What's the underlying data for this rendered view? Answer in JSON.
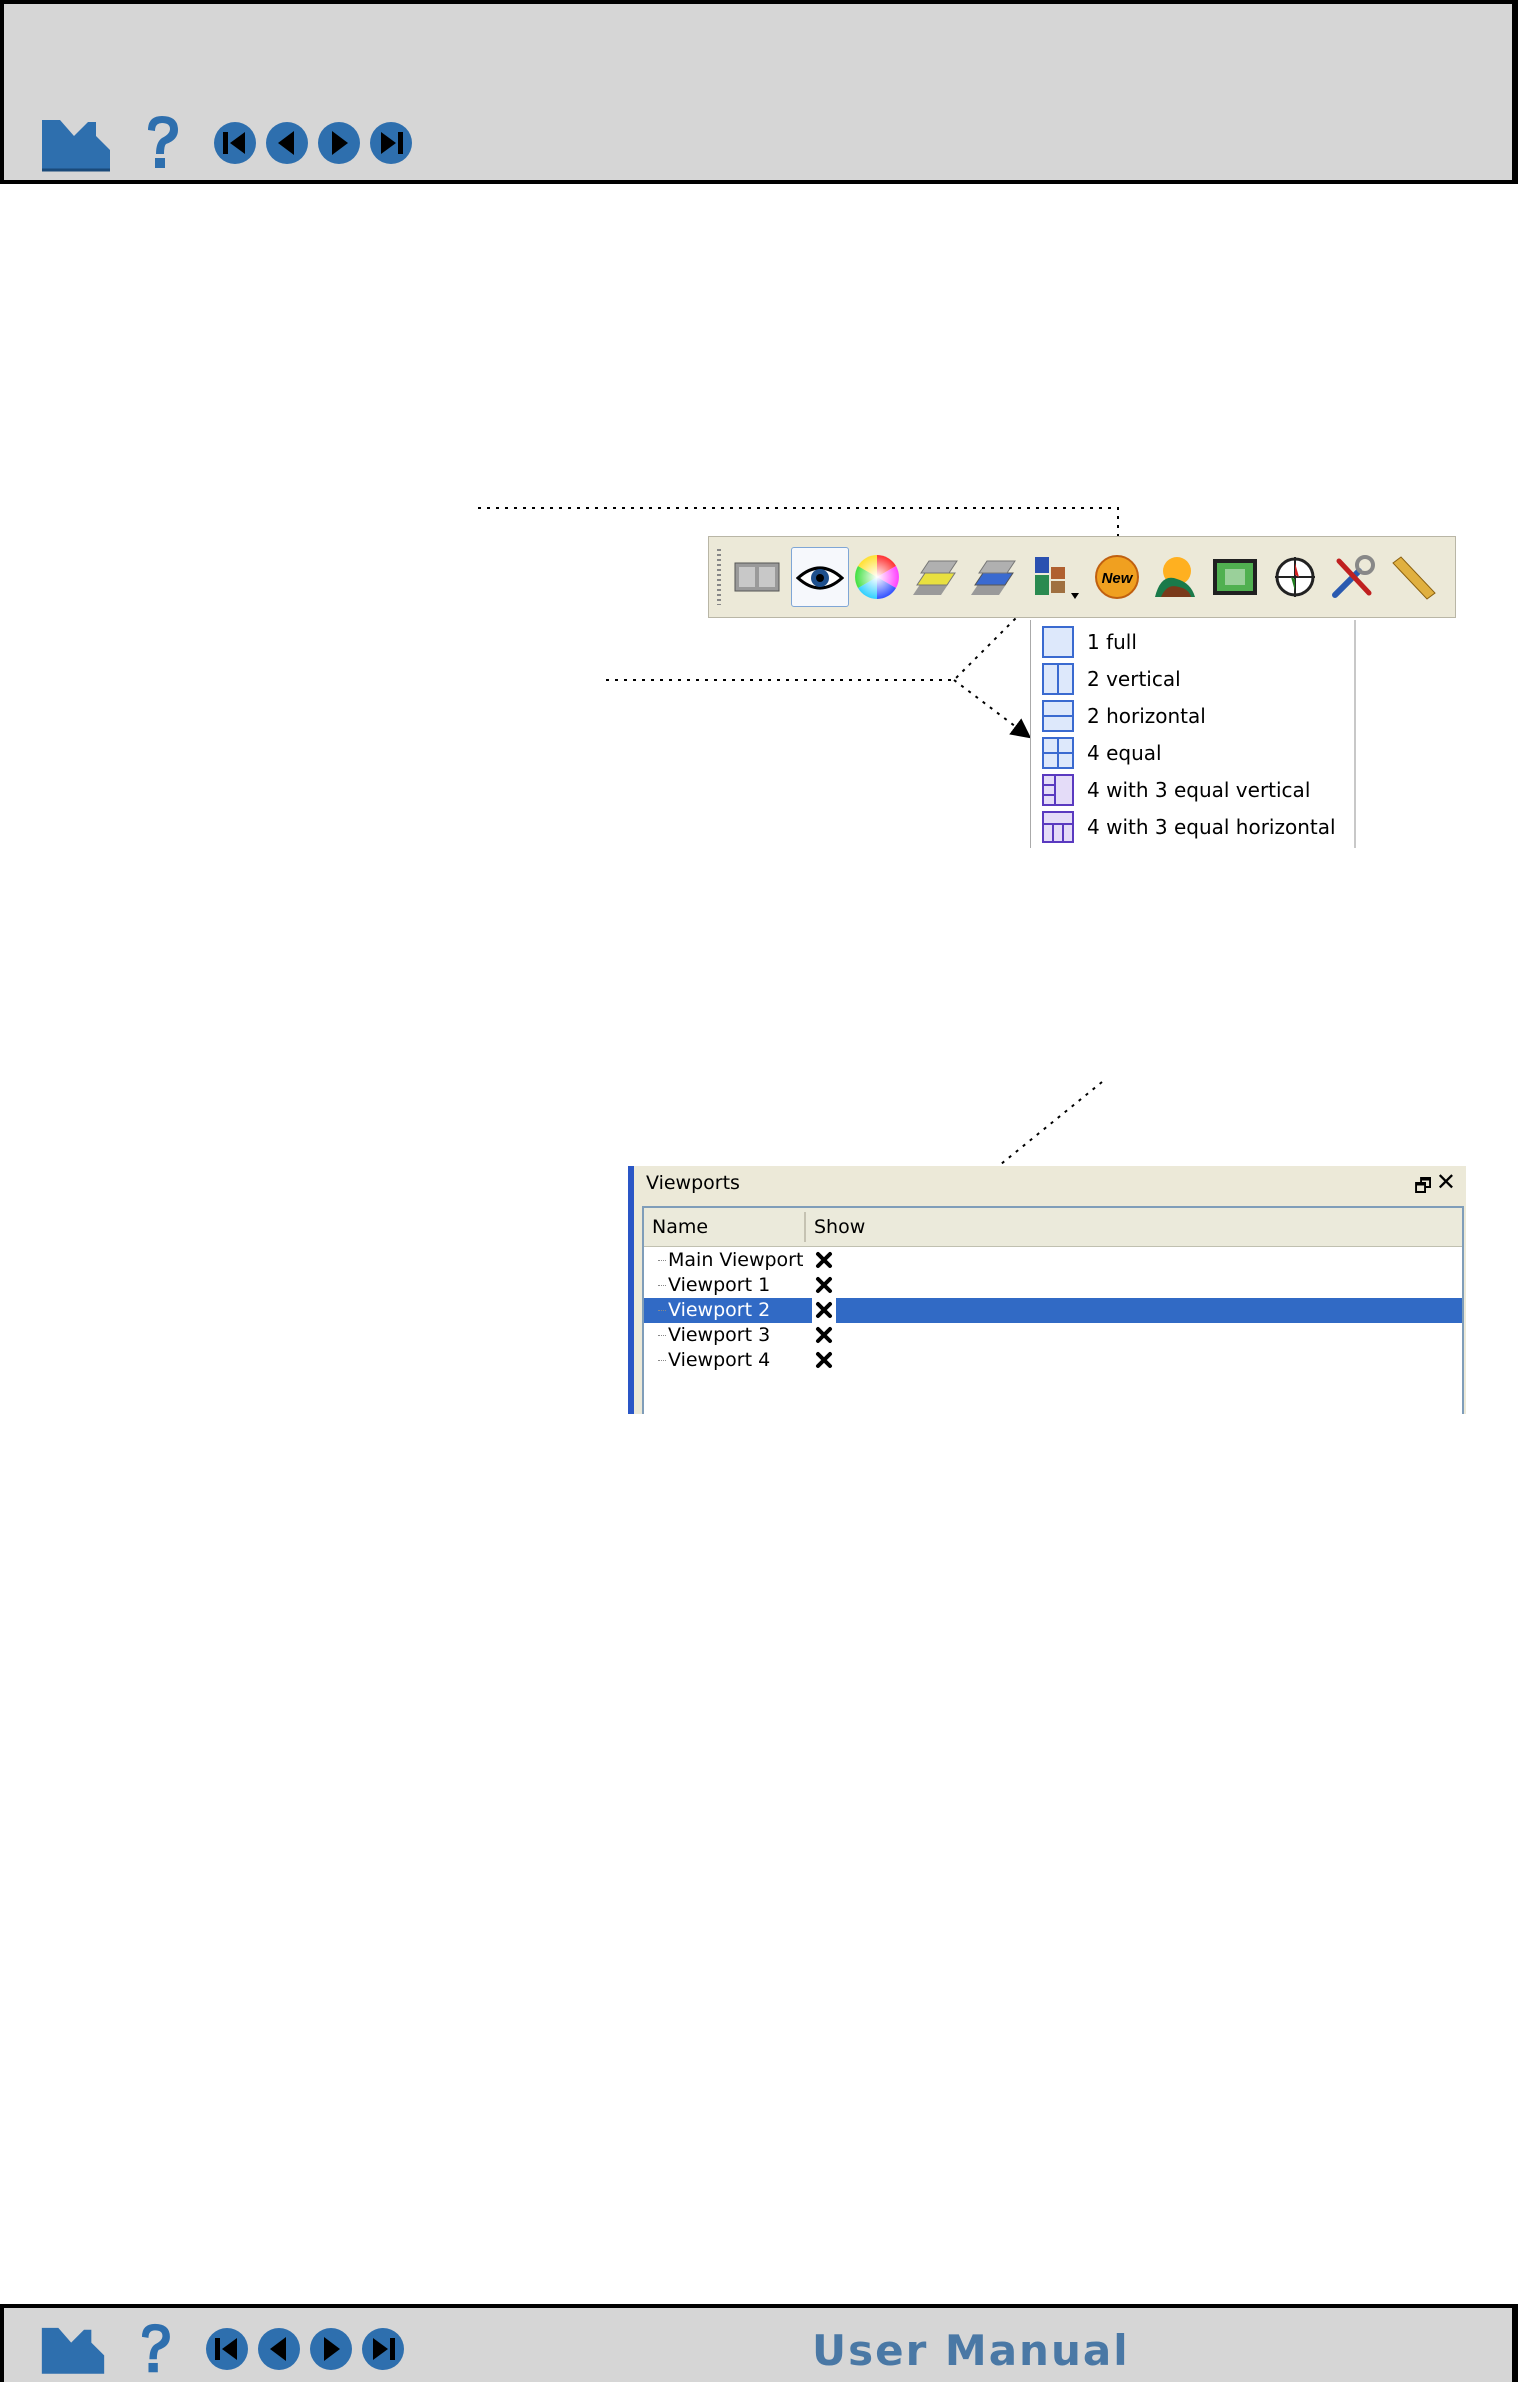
{
  "header": {
    "nav_icons": [
      "home-icon",
      "help-icon",
      "first-page-icon",
      "previous-page-icon",
      "next-page-icon",
      "last-page-icon"
    ]
  },
  "toolbar": {
    "icons": [
      "layout-panel-icon",
      "eye-icon",
      "color-wheel-icon",
      "layers-yellow-icon",
      "layers-blue-icon",
      "viewport-layout-icon",
      "new-icon",
      "surface-icon",
      "frame-icon",
      "compass-icon",
      "tools-icon",
      "ruler-icon"
    ],
    "new_label": "New"
  },
  "layout_menu": {
    "items": [
      "1 full",
      "2 vertical",
      "2 horizontal",
      "4 equal",
      "4 with 3 equal vertical",
      "4 with 3 equal horizontal"
    ]
  },
  "viewports_panel": {
    "title": "Viewports",
    "float_symbol": "🗗",
    "close_symbol": "✕",
    "columns": [
      "Name",
      "Show"
    ],
    "rows": [
      {
        "name": "Main Viewport",
        "show": true,
        "selected": false
      },
      {
        "name": "Viewport 1",
        "show": true,
        "selected": false
      },
      {
        "name": "Viewport 2",
        "show": true,
        "selected": true
      },
      {
        "name": "Viewport 3",
        "show": true,
        "selected": false
      },
      {
        "name": "Viewport 4",
        "show": true,
        "selected": false
      }
    ],
    "selection_color": "#316ac5"
  },
  "footer": {
    "title": "User Manual",
    "nav_icons": [
      "home-icon",
      "help-icon",
      "first-page-icon",
      "previous-page-icon",
      "next-page-icon",
      "last-page-icon"
    ]
  },
  "colors": {
    "nav_blue": "#2e6fae",
    "bar_gray": "#d6d6d6"
  }
}
